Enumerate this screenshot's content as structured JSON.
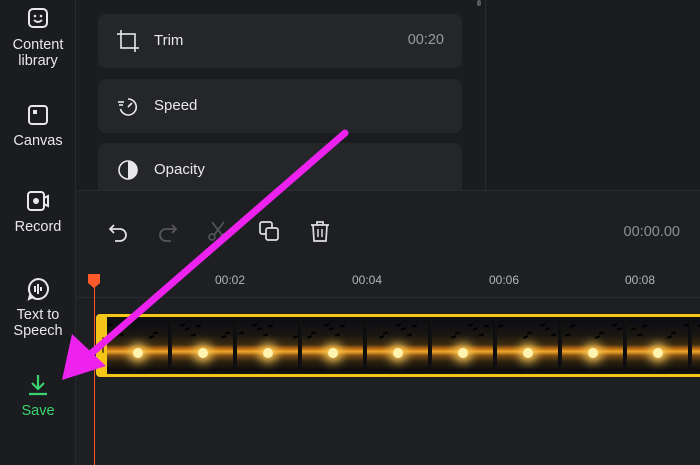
{
  "sidebar": {
    "items": [
      {
        "label_line1": "Content",
        "label_line2": "library",
        "icon": "content-library-icon"
      },
      {
        "label_line1": "Canvas",
        "label_line2": "",
        "icon": "canvas-icon"
      },
      {
        "label_line1": "Record",
        "label_line2": "",
        "icon": "record-icon"
      },
      {
        "label_line1": "Text to",
        "label_line2": "Speech",
        "icon": "text-to-speech-icon"
      },
      {
        "label_line1": "Save",
        "label_line2": "",
        "icon": "download-icon"
      }
    ]
  },
  "panel": {
    "trim": {
      "label": "Trim",
      "value": "00:20",
      "icon": "trim-icon"
    },
    "speed": {
      "label": "Speed",
      "icon": "speed-icon"
    },
    "opacity": {
      "label": "Opacity",
      "icon": "opacity-icon"
    }
  },
  "timeline": {
    "tools": [
      "undo-icon",
      "redo-icon",
      "split-icon",
      "duplicate-icon",
      "delete-icon"
    ],
    "current_time": "00:00.00",
    "ruler": [
      "00:02",
      "00:04",
      "00:06",
      "00:08"
    ]
  },
  "colors": {
    "accent_save": "#3ad26f",
    "playhead": "#ff5a2c",
    "clip_border": "#f5c518",
    "annotation_arrow": "#ee22ee"
  }
}
